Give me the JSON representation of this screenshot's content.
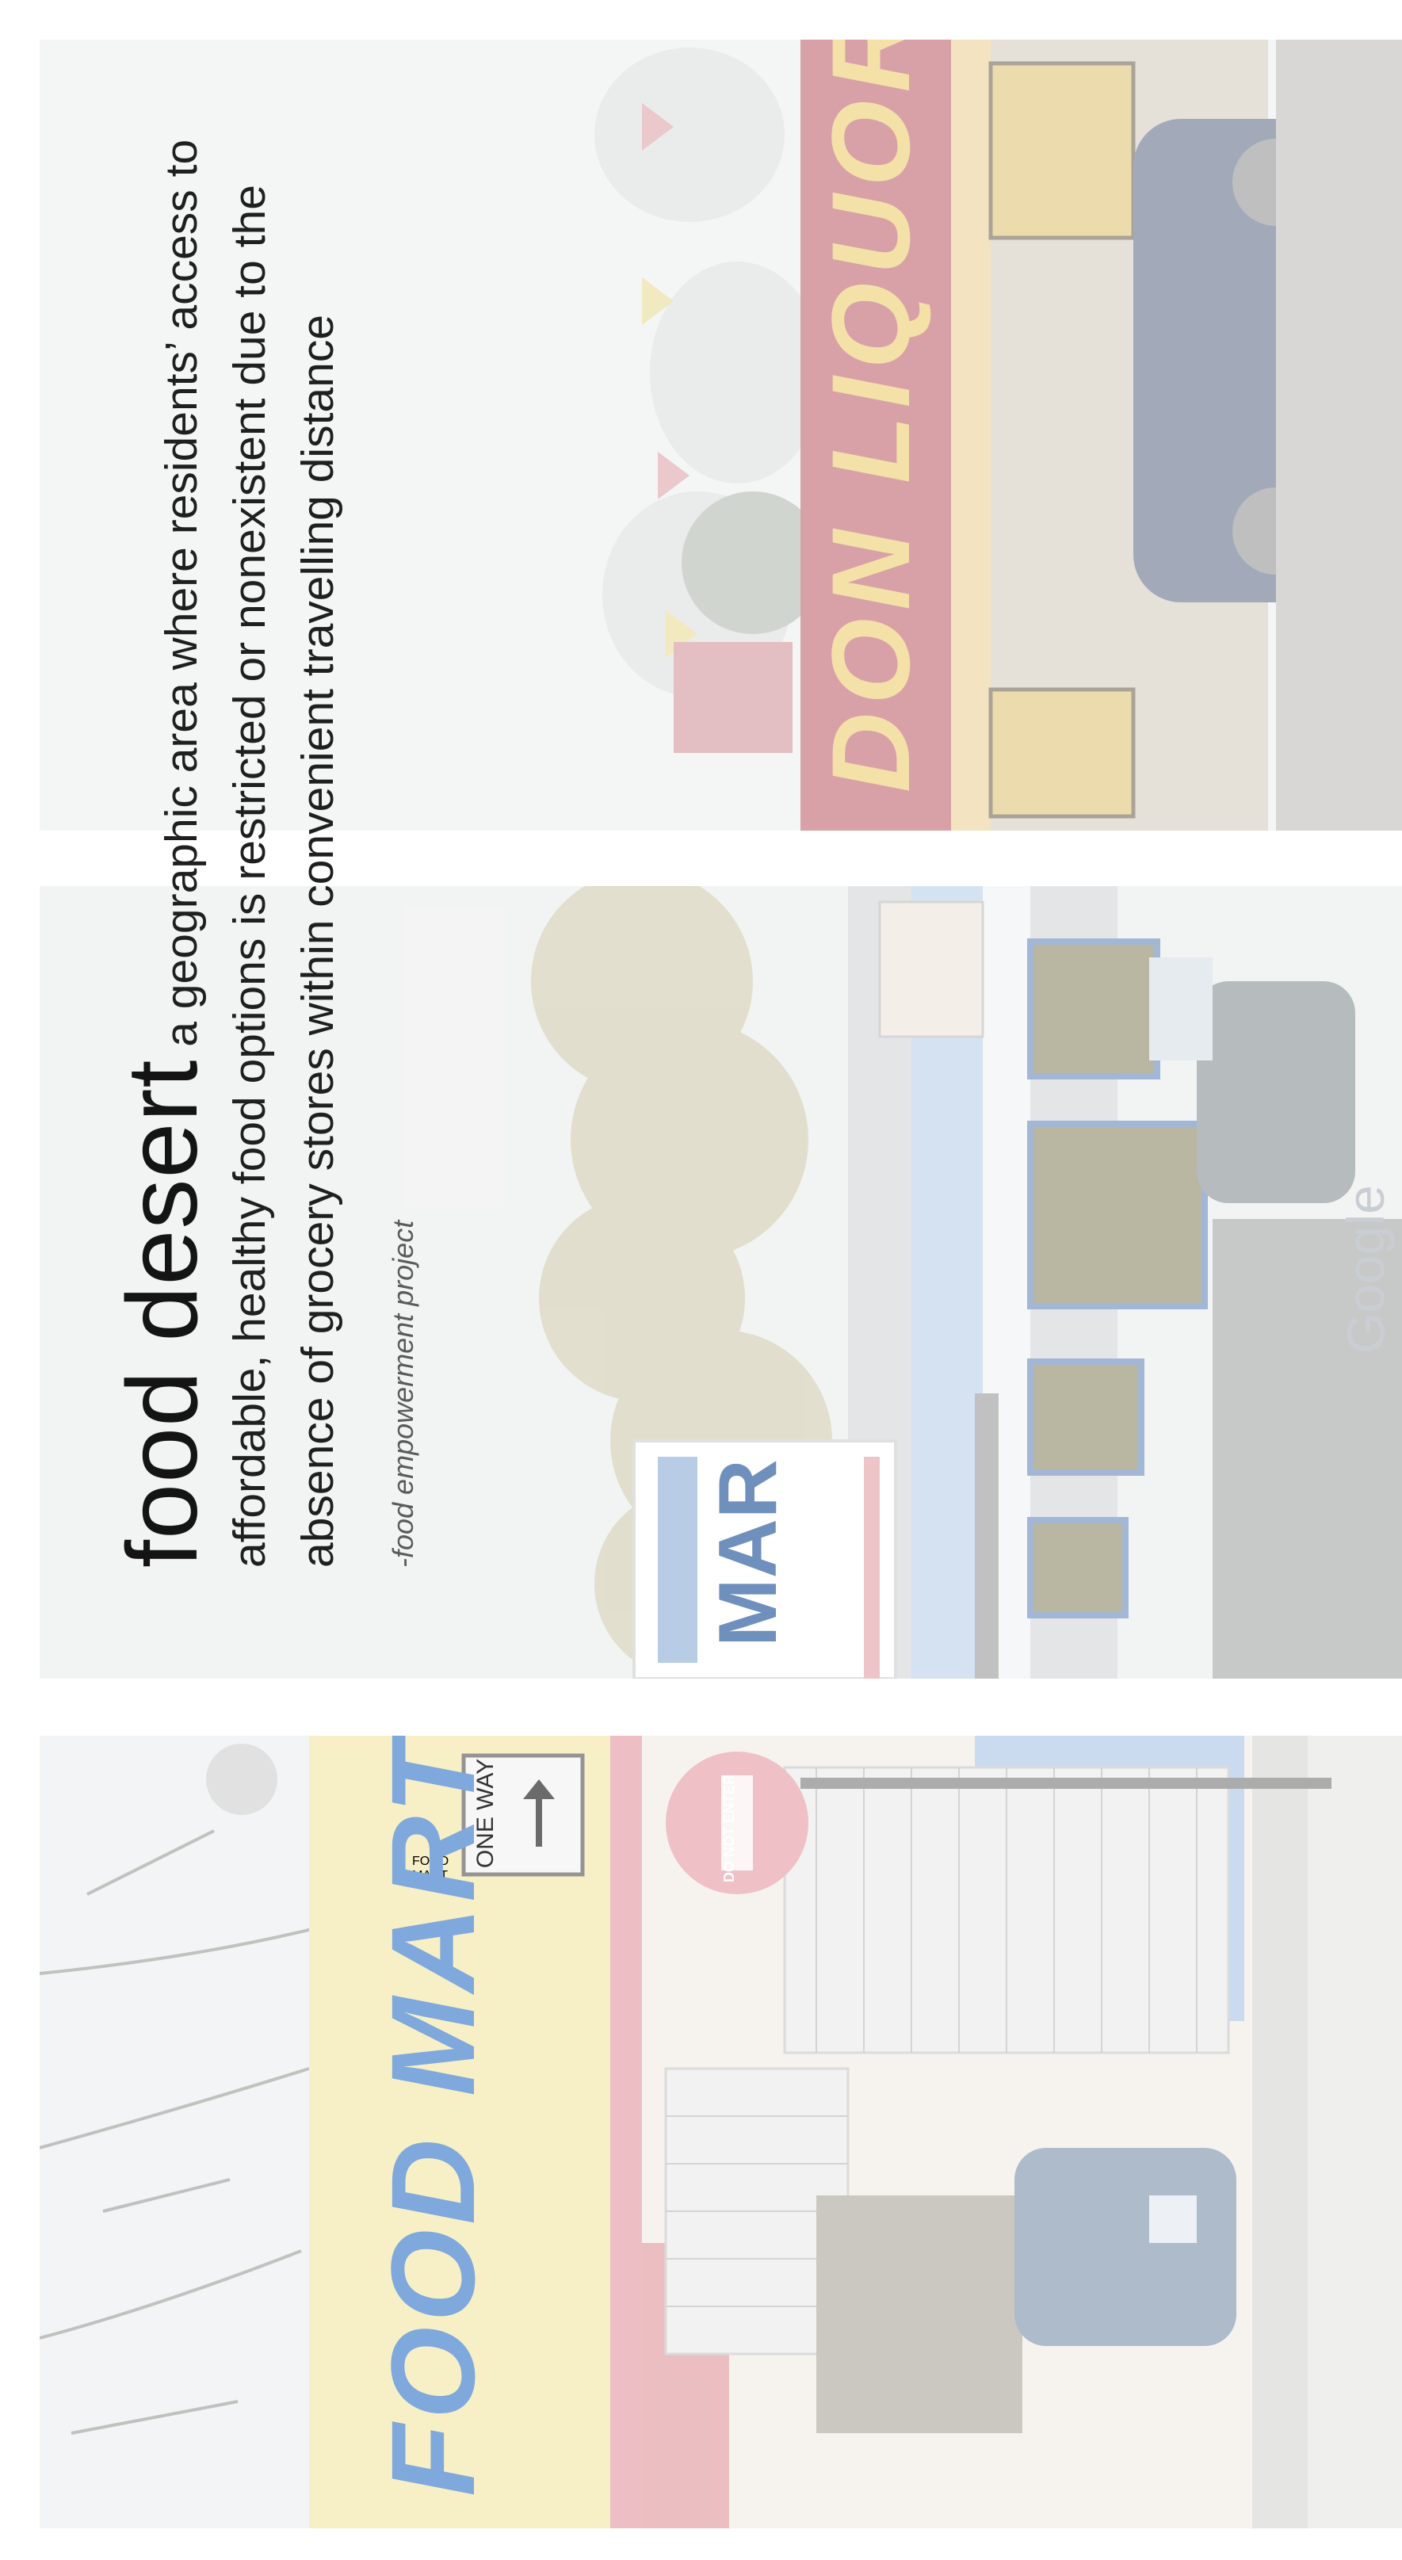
{
  "definition": {
    "term": "food desert",
    "text": " a geographic area where residents’ access to affordable, healthy food options is restricted or nonexistent due to the absence of grocery stores within convenient travelling distance",
    "attribution": "-food empowerment project"
  },
  "photos": {
    "food_mart": {
      "sign": "FOOD MART",
      "one_way_sign": "ONE WAY",
      "stop_sign": "DO NOT ENTER"
    },
    "marathon": {
      "sign": "MAR",
      "watermark": "Google"
    },
    "liquors": {
      "sign": "DON LIQUORS"
    }
  },
  "colors": {
    "text": "#1f1f1f",
    "attribution": "#5a5a5a",
    "liquor_sign_red": "#c14a5a",
    "food_mart_yellow": "#f4ebb0",
    "food_mart_blue": "#6f9cd6"
  }
}
